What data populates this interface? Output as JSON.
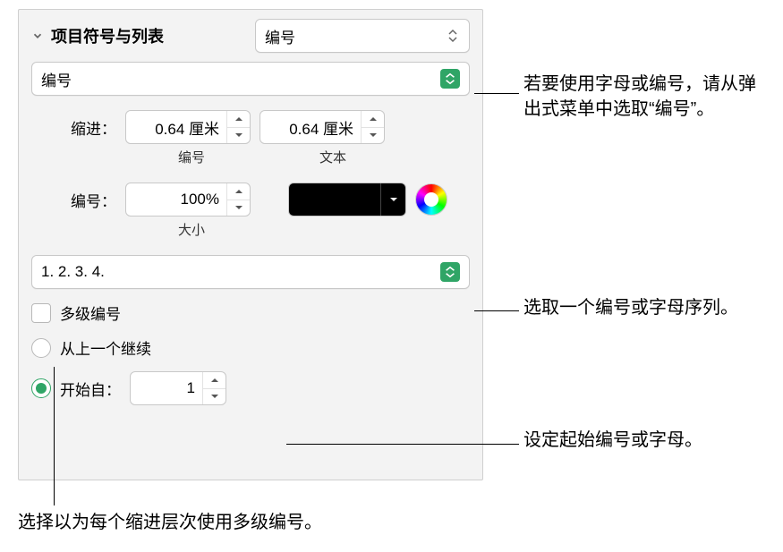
{
  "header": {
    "title": "项目符号与列表",
    "format_select": "编号"
  },
  "type_select": "编号",
  "indent": {
    "label": "缩进：",
    "number_value": "0.64 厘米",
    "number_sublabel": "编号",
    "text_value": "0.64 厘米",
    "text_sublabel": "文本"
  },
  "number": {
    "label": "编号：",
    "size_value": "100%",
    "size_sublabel": "大小",
    "color": "#000000"
  },
  "sequence_select": "1. 2. 3. 4.",
  "multilevel": {
    "label": "多级编号",
    "checked": false
  },
  "continue": {
    "label": "从上一个继续",
    "selected": false
  },
  "start_from": {
    "label": "开始自：",
    "value": "1",
    "selected": true
  },
  "callouts": {
    "c1": "若要使用字母或编号，请从弹出式菜单中选取“编号”。",
    "c2": "选取一个编号或字母序列。",
    "c3": "设定起始编号或字母。",
    "c4": "选择以为每个缩进层次使用多级编号。"
  }
}
